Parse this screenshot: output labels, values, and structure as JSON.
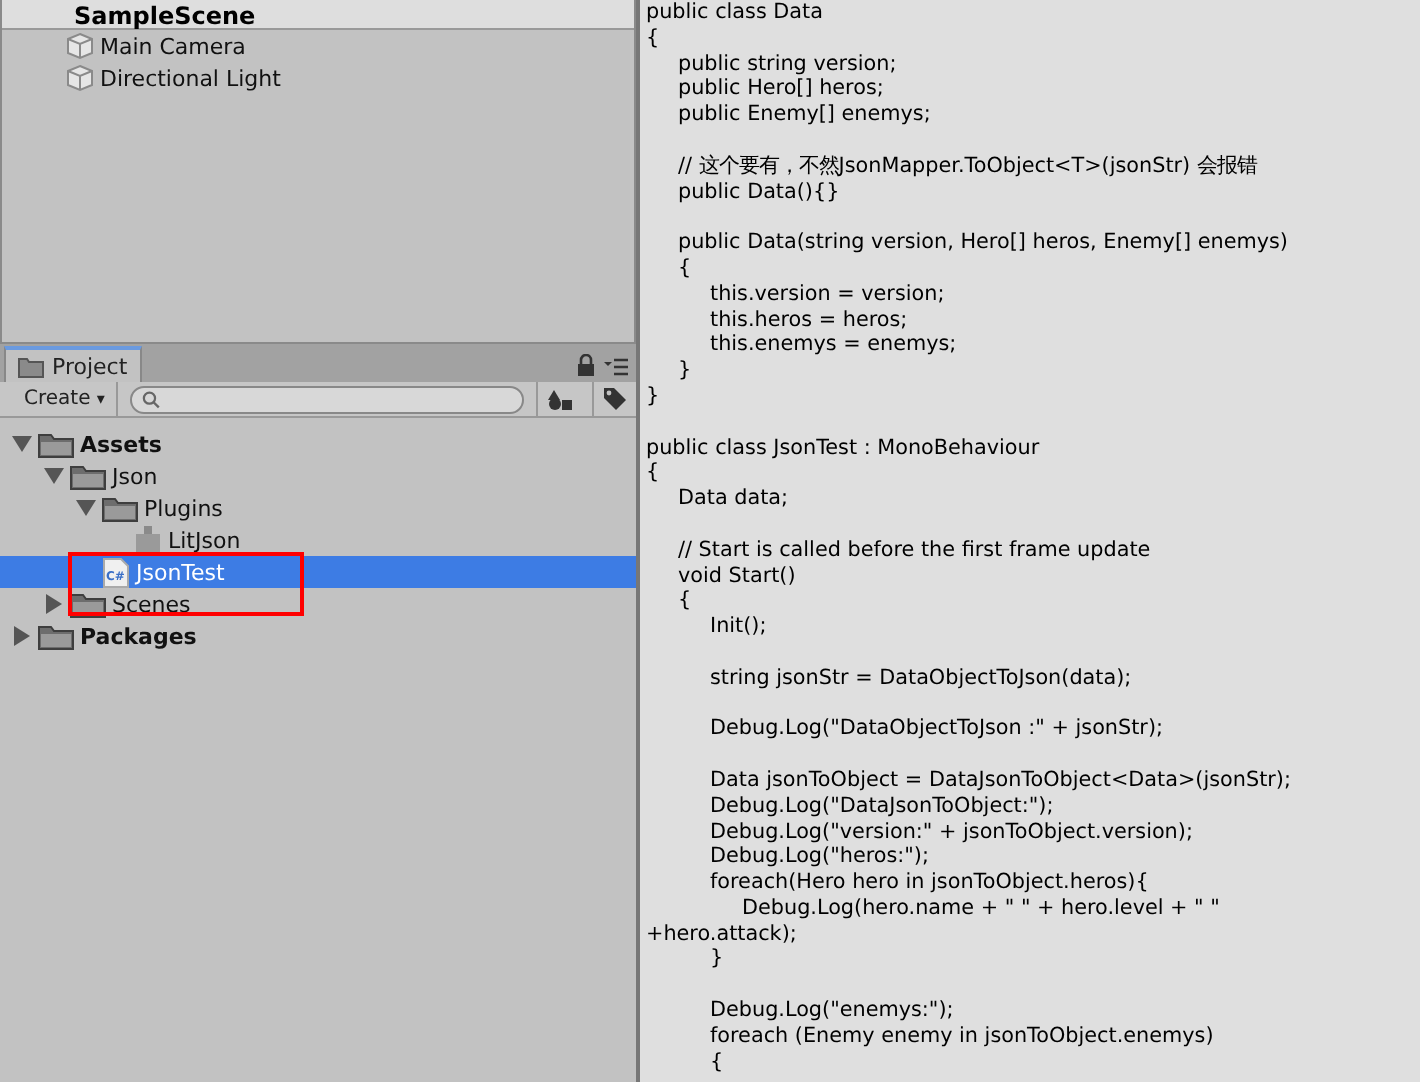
{
  "hierarchy": {
    "scene": "SampleScene",
    "objects": [
      {
        "name": "Main Camera",
        "selected": false
      },
      {
        "name": "Directional Light",
        "selected": false
      }
    ]
  },
  "project": {
    "tab": {
      "label": "Project",
      "selected": true
    },
    "create_button": "Create",
    "create_caret": "▾",
    "tree": [
      {
        "name": "Assets",
        "kind": "folder",
        "bold": true,
        "expanded": true,
        "selected": false,
        "children": [
          {
            "name": "Json",
            "kind": "folder",
            "bold": false,
            "expanded": true,
            "selected": false,
            "children": [
              {
                "name": "Plugins",
                "kind": "folder",
                "bold": false,
                "expanded": true,
                "selected": false,
                "children": [
                  {
                    "name": "LitJson",
                    "kind": "asset",
                    "bold": false,
                    "selected": false
                  }
                ]
              },
              {
                "name": "JsonTest",
                "kind": "script",
                "icon_label": "C#",
                "bold": false,
                "selected": true,
                "highlighted": true
              }
            ]
          },
          {
            "name": "Scenes",
            "kind": "folder",
            "bold": false,
            "expanded": false,
            "selected": false
          }
        ]
      },
      {
        "name": "Packages",
        "kind": "folder",
        "bold": true,
        "expanded": false,
        "selected": false
      }
    ]
  },
  "code_blocks": [
    [
      "public class Data",
      "{",
      "\tpublic string version;",
      "\tpublic Hero[] heros;",
      "\tpublic Enemy[] enemys;"
    ],
    [
      "\t// 这个要有，不然JsonMapper.ToObject<T>(jsonStr) 会报错",
      "\tpublic Data(){}"
    ],
    [
      "\tpublic Data(string version, Hero[] heros, Enemy[] enemys)",
      "\t{",
      "\t\tthis.version = version;",
      "\t\tthis.heros = heros;",
      "\t\tthis.enemys = enemys;",
      "\t}",
      "}"
    ],
    [
      "public class JsonTest : MonoBehaviour",
      "{",
      "\tData data;"
    ],
    [
      "\t// Start is called before the first frame update",
      "\tvoid Start()",
      "\t{",
      "\t\tInit();"
    ],
    [
      "\t\tstring jsonStr = DataObjectToJson(data);"
    ],
    [
      "\t\tDebug.Log(\"DataObjectToJson :\" + jsonStr);"
    ],
    [
      "\t\tData jsonToObject = DataJsonToObject<Data>(jsonStr);",
      "\t\tDebug.Log(\"DataJsonToObject:\");",
      "\t\tDebug.Log(\"version:\" + jsonToObject.version);",
      "\t\tDebug.Log(\"heros:\");",
      "\t\tforeach(Hero hero in jsonToObject.heros){",
      "\t\t\tDebug.Log(hero.name + \" \" + hero.level + \" \"",
      "+hero.attack);",
      "\t\t}"
    ],
    [
      "\t\tDebug.Log(\"enemys:\");",
      "\t\tforeach (Enemy enemy in jsonToObject.enemys)",
      "\t\t{"
    ]
  ]
}
